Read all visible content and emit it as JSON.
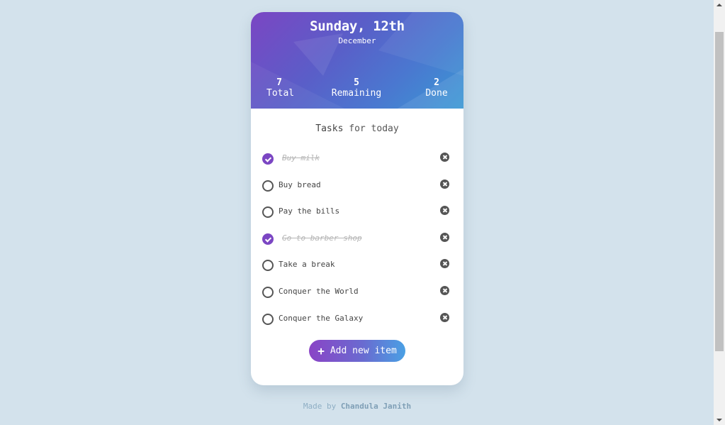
{
  "header": {
    "date_title": "Sunday, 12th",
    "month": "December",
    "stats": [
      {
        "value": "7",
        "label": "Total"
      },
      {
        "value": "5",
        "label": "Remaining"
      },
      {
        "value": "2",
        "label": "Done"
      }
    ]
  },
  "tasks": {
    "heading_strong": "Tasks",
    "heading_rest": " for today",
    "items": [
      {
        "text": "Buy milk",
        "done": true
      },
      {
        "text": "Buy bread",
        "done": false
      },
      {
        "text": "Pay the bills",
        "done": false
      },
      {
        "text": "Go to barber shop",
        "done": true
      },
      {
        "text": "Take a break",
        "done": false
      },
      {
        "text": "Conquer the World",
        "done": false
      },
      {
        "text": "Conquer the Galaxy",
        "done": false
      }
    ]
  },
  "add_button": {
    "icon": "+",
    "label": "Add new item"
  },
  "footer": {
    "prefix": "Made by ",
    "author": "Chandula Janith"
  },
  "colors": {
    "accent": "#7b46c3",
    "background": "#d3e2ec"
  }
}
